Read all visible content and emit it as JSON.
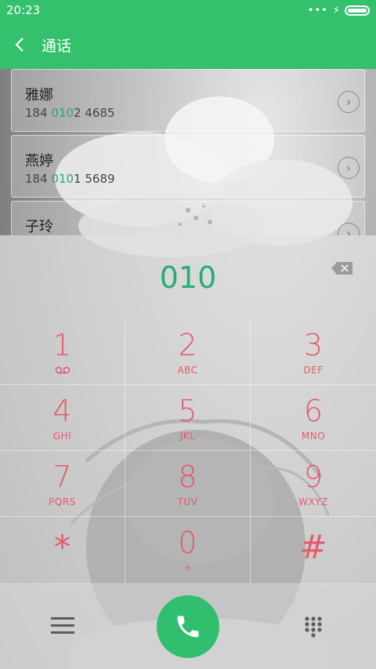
{
  "status": {
    "time": "20:23"
  },
  "header": {
    "back_icon": "chevron-left-icon",
    "title": "通话"
  },
  "contacts": [
    {
      "name": "雅娜",
      "num_pre": "184 ",
      "num_hl": "010",
      "num_post": "2 4685"
    },
    {
      "name": "燕婷",
      "num_pre": "184 ",
      "num_hl": "010",
      "num_post": "1 5689"
    },
    {
      "name": "子玲",
      "num_pre": "",
      "num_hl": "",
      "num_post": ""
    }
  ],
  "dial": {
    "entered": "010"
  },
  "keypad": [
    {
      "digit": "1",
      "letters": ""
    },
    {
      "digit": "2",
      "letters": "ABC"
    },
    {
      "digit": "3",
      "letters": "DEF"
    },
    {
      "digit": "4",
      "letters": "GHI"
    },
    {
      "digit": "5",
      "letters": "JKL"
    },
    {
      "digit": "6",
      "letters": "MNO"
    },
    {
      "digit": "7",
      "letters": "PQRS"
    },
    {
      "digit": "8",
      "letters": "TUV"
    },
    {
      "digit": "9",
      "letters": "WXYZ"
    },
    {
      "digit": "*",
      "letters": ""
    },
    {
      "digit": "0",
      "letters": "+"
    },
    {
      "digit": "#",
      "letters": ""
    }
  ],
  "colors": {
    "accent": "#34c06d",
    "digits": "#e35a6b",
    "entered": "#27ae74"
  }
}
